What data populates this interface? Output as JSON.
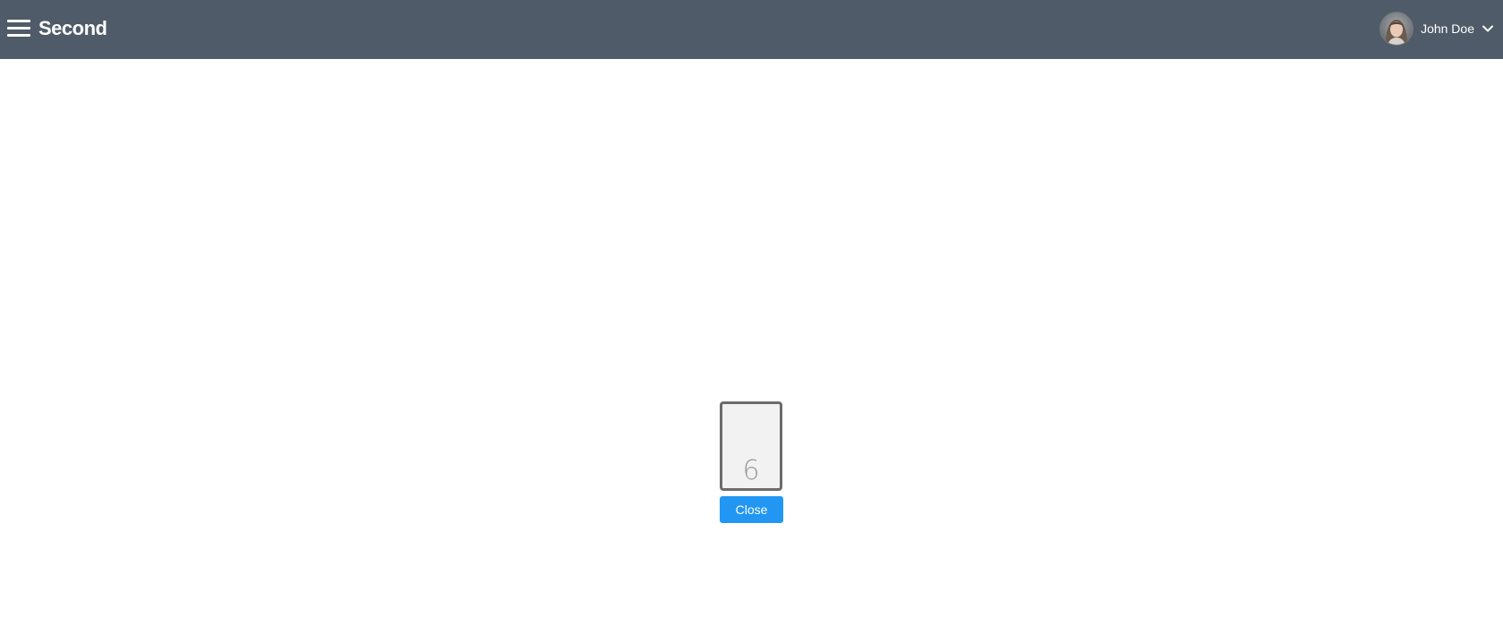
{
  "header": {
    "title": "Second",
    "menu_icon": "hamburger-menu-icon",
    "user": {
      "name": "John Doe",
      "avatar_icon": "user-avatar",
      "dropdown_icon": "chevron-down-icon"
    }
  },
  "main": {
    "card": {
      "value": "6"
    },
    "close_button_label": "Close"
  },
  "colors": {
    "header_bg": "#4f5b68",
    "button_bg": "#2196f3",
    "card_border": "#6b6b6b",
    "card_bg": "#f2f2f2"
  }
}
